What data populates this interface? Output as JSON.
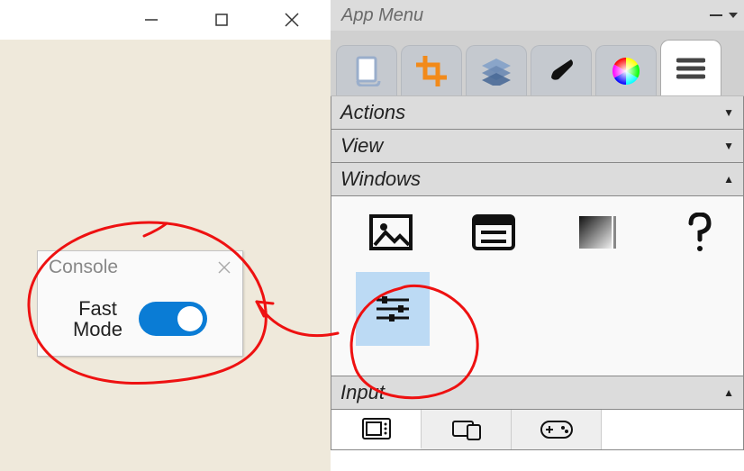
{
  "window_controls": {
    "minimize": "minimize",
    "maximize": "maximize",
    "close": "close"
  },
  "console": {
    "title": "Console",
    "fast_mode_label_line1": "Fast",
    "fast_mode_label_line2": "Mode",
    "toggle_on": true
  },
  "app_menu": {
    "title": "App Menu",
    "tabs": [
      {
        "name": "page-icon"
      },
      {
        "name": "crop-icon"
      },
      {
        "name": "layers-icon"
      },
      {
        "name": "brush-icon"
      },
      {
        "name": "color-wheel-icon"
      },
      {
        "name": "hamburger-icon"
      }
    ],
    "sections": {
      "actions": "Actions",
      "view": "View",
      "windows": "Windows",
      "input": "Input"
    },
    "windows_items": [
      {
        "name": "image-preview-icon"
      },
      {
        "name": "list-icon"
      },
      {
        "name": "gradient-icon"
      },
      {
        "name": "help-icon"
      },
      {
        "name": "sliders-icon"
      }
    ],
    "input_tabs": [
      {
        "name": "tablet-icon"
      },
      {
        "name": "devices-icon"
      },
      {
        "name": "gamepad-icon"
      }
    ]
  }
}
